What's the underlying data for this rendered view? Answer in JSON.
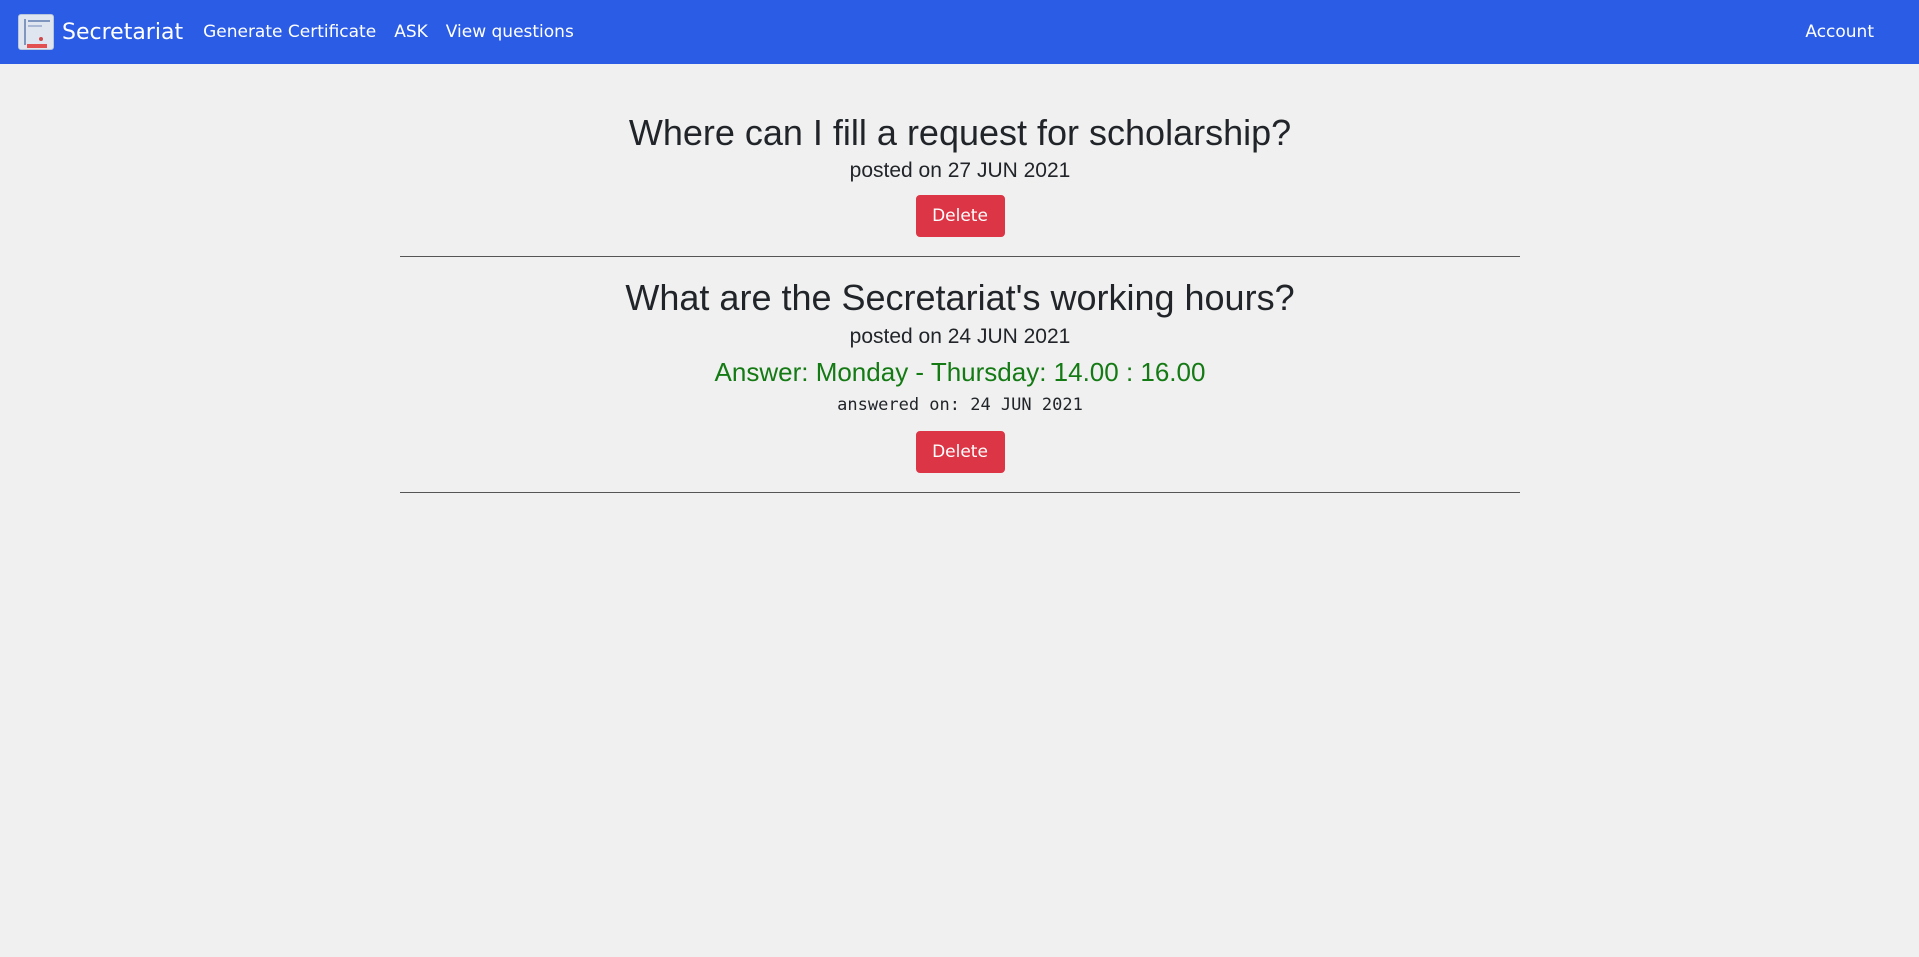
{
  "navbar": {
    "brand": "Secretariat",
    "links": [
      "Generate Certificate",
      "ASK",
      "View questions"
    ],
    "account": "Account",
    "bg_color": "#2b5ce6"
  },
  "questions": [
    {
      "title": "Where can I fill a request for scholarship?",
      "posted": "posted on 27 JUN 2021",
      "delete_label": "Delete"
    },
    {
      "title": "What are the Secretariat's working hours?",
      "posted": "posted on 24 JUN 2021",
      "answer": "Answer: Monday - Thursday: 14.00 : 16.00",
      "answered_on": "answered on: 24 JUN 2021",
      "delete_label": "Delete"
    }
  ],
  "colors": {
    "delete_button": "#dc3545",
    "answer_text": "#147a14",
    "page_background": "#f0f0f0"
  }
}
